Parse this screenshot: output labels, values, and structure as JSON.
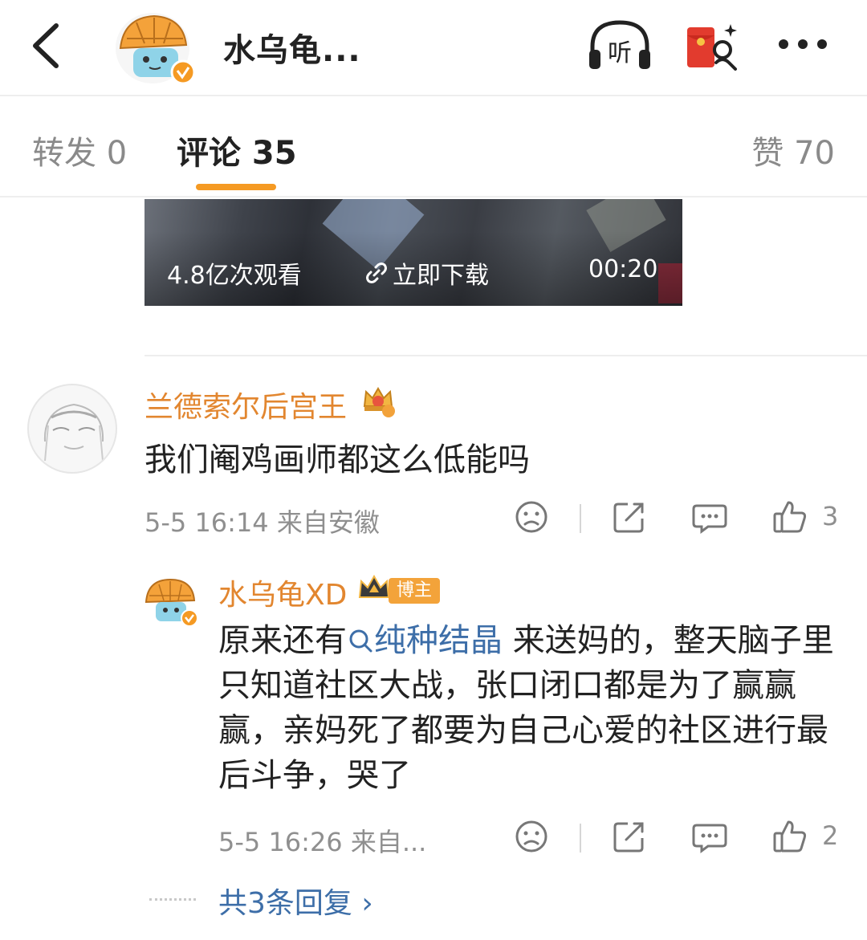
{
  "header": {
    "title": "水乌龟...",
    "back_icon": "chevron-left-icon",
    "listen_label": "听",
    "redpacket_icon": "red-packet-icon",
    "more_icon": "more-dots-icon"
  },
  "tabs": {
    "repost": "转发 0",
    "comments": "评论 35",
    "likes": "赞 70",
    "active_color": "#f59a23"
  },
  "video": {
    "views": "4.8亿次观看",
    "download": "立即下载",
    "duration": "00:20"
  },
  "comments": [
    {
      "username": "兰德索尔后宫王",
      "text": "我们阉鸡画师都这么低能吗",
      "meta": "5-5 16:14 来自安徽",
      "likes": "3"
    }
  ],
  "reply": {
    "username": "水乌龟XD",
    "author_tag": "博主",
    "text_before": "原来还有",
    "mention": "纯种结晶",
    "text_after": " 来送妈的，整天脑子里只知道社区大战，张口闭口都是为了赢赢赢，亲妈死了都要为自己心爱的社区进行最后斗争，哭了",
    "meta": "5-5 16:26 来自...",
    "likes": "2"
  },
  "more_replies": "共3条回复 ›",
  "colors": {
    "username": "#e2862f",
    "link": "#3d6ea8",
    "meta": "#8f8f8f"
  }
}
